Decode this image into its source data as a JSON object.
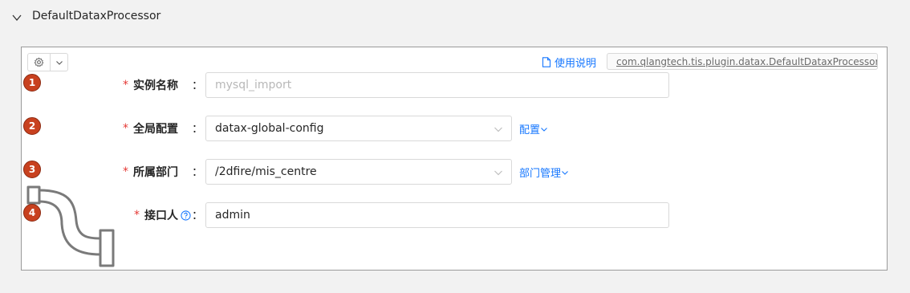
{
  "panel": {
    "title": "DefaultDataxProcessor"
  },
  "toolbar": {
    "doc_label": "使用说明",
    "impl_class": "com.qlangtech.tis.plugin.datax.DefaultDataxProcessor"
  },
  "fields": [
    {
      "badge": "1",
      "label": "实例名称",
      "value": "mysql_import",
      "is_placeholder": true
    },
    {
      "badge": "2",
      "label": "全局配置",
      "value": "datax-global-config",
      "action": "配置"
    },
    {
      "badge": "3",
      "label": "所属部门",
      "value": "/2dfire/mis_centre",
      "action": "部门管理"
    },
    {
      "badge": "4",
      "label": "接口人",
      "value": "admin"
    }
  ],
  "colon": "：",
  "required_mark": "*",
  "colors": {
    "accent": "#1677ff",
    "required": "#e53935",
    "badge": "#c8411f"
  }
}
